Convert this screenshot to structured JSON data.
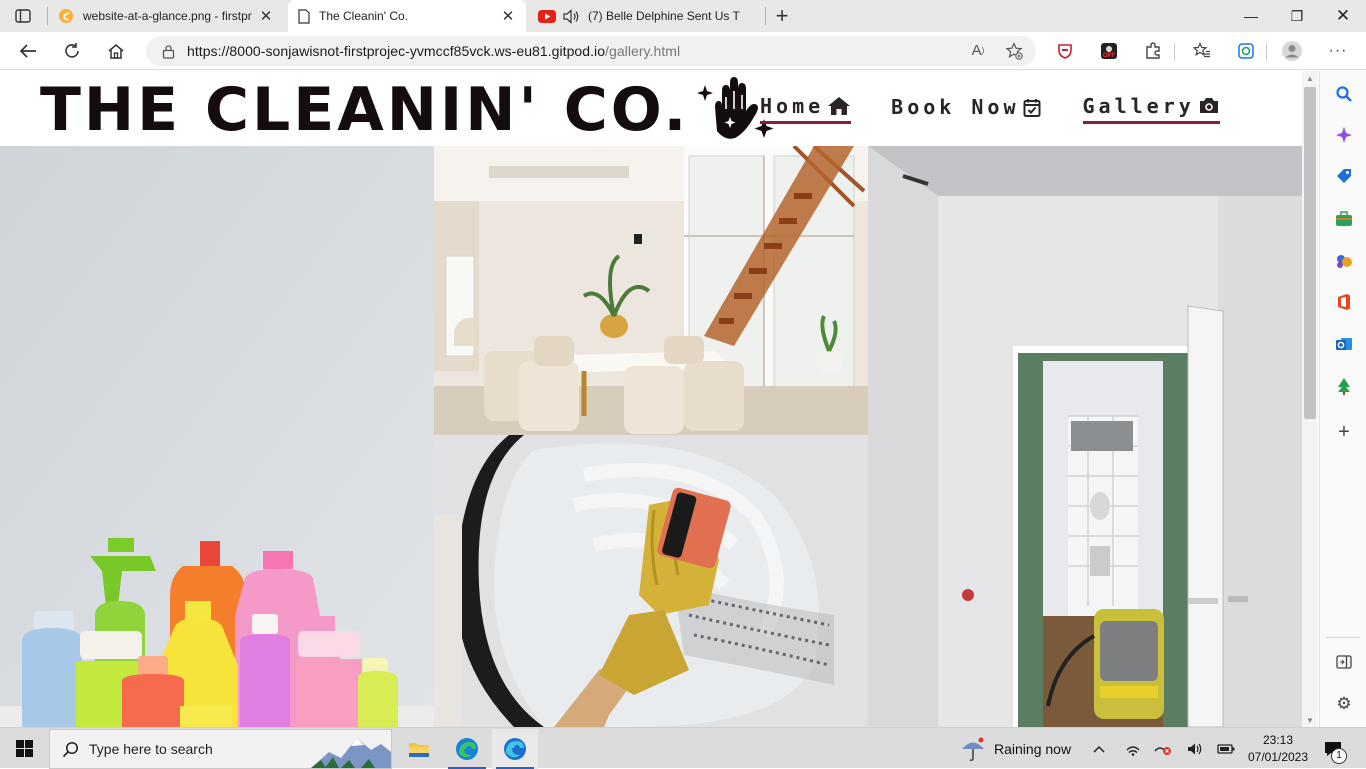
{
  "browser": {
    "tabs": [
      {
        "title": "website-at-a-glance.png - firstpr",
        "icon": "gitpod-icon",
        "active": false
      },
      {
        "title": "The Cleanin' Co.",
        "icon": "page-icon",
        "active": true
      },
      {
        "title": "(7) Belle Delphine Sent Us T",
        "icon": "youtube-icon",
        "active": false
      }
    ],
    "url_host": "https://8000-sonjawisnot-firstprojec-yvmccf85vck.ws-eu81.gitpod.io",
    "url_path": "/gallery.html",
    "read_aloud_label": "A"
  },
  "site": {
    "brand": "THE CLEANIN' CO.",
    "nav": [
      {
        "label": "Home",
        "icon": "house-icon",
        "underlined": true
      },
      {
        "label": "Book Now",
        "icon": "calendar-check-icon",
        "underlined": false
      },
      {
        "label": "Gallery",
        "icon": "camera-icon",
        "underlined": true
      }
    ],
    "accent": "#8c1d3a",
    "gallery": [
      {
        "name": "cleaning-bottles-image",
        "subject": "colorful cleaning bottles"
      },
      {
        "name": "dining-room-image",
        "subject": "bright dining room with staircase"
      },
      {
        "name": "scrubbing-glass-image",
        "subject": "gloved hand scrubbing glass"
      },
      {
        "name": "bathroom-renovation-image",
        "subject": "doorway to bathroom with vacuum"
      }
    ]
  },
  "taskbar": {
    "search_placeholder": "Type here to search",
    "weather": "Raining now",
    "time": "23:13",
    "date": "07/01/2023",
    "notification_count": "1"
  }
}
